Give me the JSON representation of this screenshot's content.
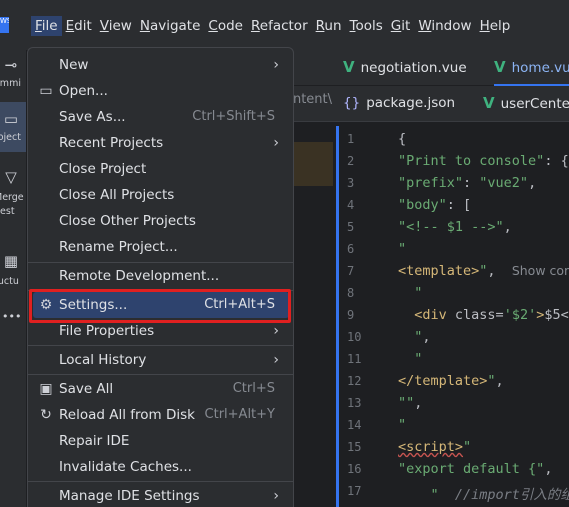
{
  "menubar": {
    "logo": "WS",
    "items": [
      {
        "mnemonic": "F",
        "rest": "ile"
      },
      {
        "mnemonic": "E",
        "rest": "dit"
      },
      {
        "mnemonic": "V",
        "rest": "iew"
      },
      {
        "mnemonic": "N",
        "rest": "avigate"
      },
      {
        "mnemonic": "C",
        "rest": "ode"
      },
      {
        "mnemonic": "R",
        "rest": "efactor"
      },
      {
        "mnemonic": "R",
        "rest": "un"
      },
      {
        "mnemonic": "T",
        "rest": "ools"
      },
      {
        "mnemonic": "G",
        "rest": "it"
      },
      {
        "mnemonic": "W",
        "rest": "indow"
      },
      {
        "mnemonic": "H",
        "rest": "elp"
      }
    ]
  },
  "toolstrip": {
    "commit_label": "ommi",
    "project_label": "roject",
    "merge_label1": "Merge",
    "merge_label2": "uest",
    "structure_label": "ructu",
    "more": "•••"
  },
  "file_menu": {
    "items": {
      "new": "New",
      "open": "Open...",
      "save_as": "Save As...",
      "save_as_shortcut": "Ctrl+Shift+S",
      "recent_projects": "Recent Projects",
      "close_project": "Close Project",
      "close_all_projects": "Close All Projects",
      "close_other_projects": "Close Other Projects",
      "rename_project": "Rename Project...",
      "remote_development": "Remote Development...",
      "settings": "Settings...",
      "settings_shortcut": "Ctrl+Alt+S",
      "file_properties": "File Properties",
      "local_history": "Local History",
      "save_all": "Save All",
      "save_all_shortcut": "Ctrl+S",
      "reload_all": "Reload All from Disk",
      "reload_all_shortcut": "Ctrl+Alt+Y",
      "repair_ide": "Repair IDE",
      "invalidate_caches": "Invalidate Caches...",
      "manage_ide_settings": "Manage IDE Settings"
    }
  },
  "editor": {
    "tabs_row1": [
      {
        "label": "negotiation.vue",
        "active": false
      },
      {
        "label": "home.vue",
        "active": true
      }
    ],
    "tabs_row2": [
      {
        "label": "package.json"
      },
      {
        "label": "userCenter.vue"
      }
    ],
    "partial_path": "ontent\\",
    "line_numbers": [
      "1",
      "2",
      "3",
      "4",
      "5",
      "6",
      "7",
      "8",
      "9",
      "10",
      "11",
      "12",
      "13",
      "14",
      "15",
      "16",
      "17"
    ],
    "inlay_hint": "Show com"
  },
  "colors": {
    "accent": "#3574f0",
    "highlight": "#2e436e",
    "red_box": "#e02020"
  }
}
